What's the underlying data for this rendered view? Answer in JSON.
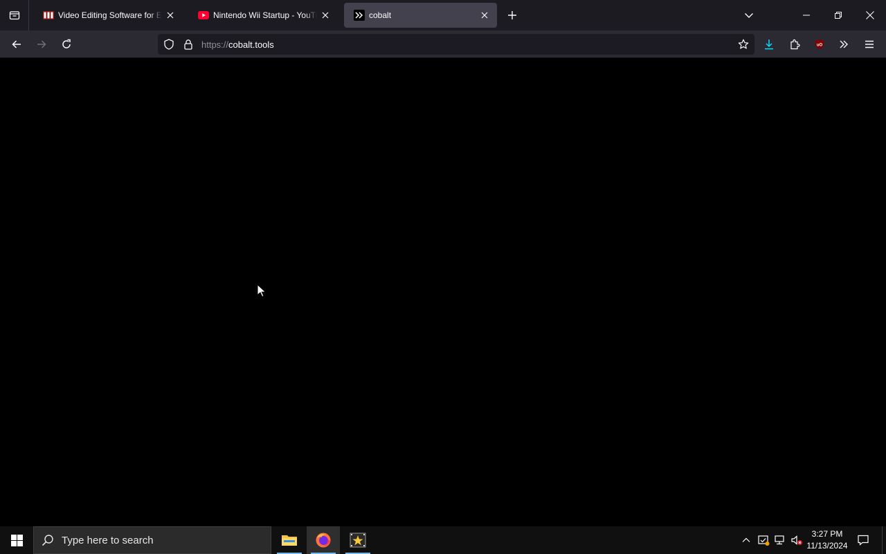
{
  "browser": {
    "tabs": [
      {
        "title": "Video Editing Software for Everyone",
        "favicon": "nch-logo-icon",
        "active": false
      },
      {
        "title": "Nintendo Wii Startup - YouTube",
        "favicon": "youtube-icon",
        "active": false
      },
      {
        "title": "cobalt",
        "favicon": "cobalt-icon",
        "active": true
      }
    ],
    "url": {
      "scheme": "https://",
      "host": "cobalt.tools"
    },
    "accent_colors": {
      "active_tab": "#42414d",
      "download": "#00ddff",
      "youtube": "#ff0033",
      "ublock": "#800000"
    }
  },
  "taskbar": {
    "search_placeholder": "Type here to search",
    "apps": [
      "file-explorer-icon",
      "firefox-icon",
      "movie-maker-icon"
    ],
    "clock": {
      "time": "3:27 PM",
      "date": "11/13/2024"
    }
  }
}
